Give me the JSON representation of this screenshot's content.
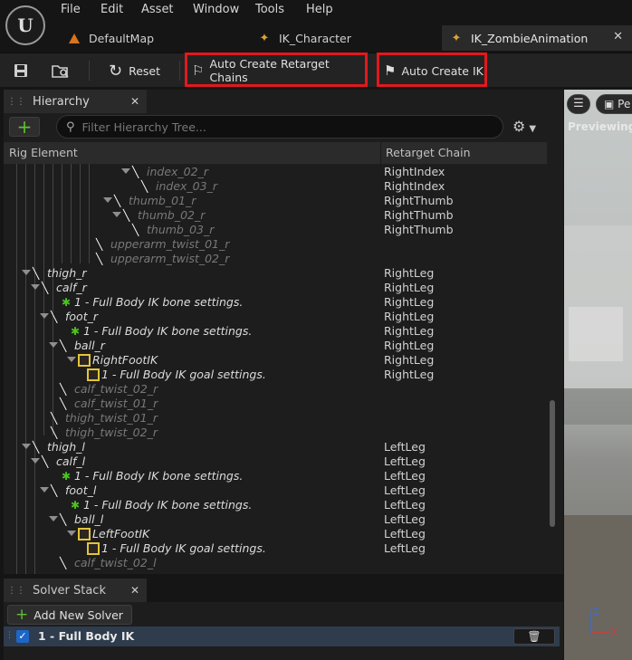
{
  "menu": [
    "File",
    "Edit",
    "Asset",
    "Window",
    "Tools",
    "Help"
  ],
  "tabs": [
    {
      "label": "DefaultMap",
      "icon": "level-map-icon"
    },
    {
      "label": "IK_Character",
      "icon": "ik-rig-icon"
    },
    {
      "label": "IK_ZombieAnimation",
      "icon": "ik-rig-icon"
    }
  ],
  "toolbar": {
    "reset_label": "Reset",
    "auto_retarget_label": "Auto Create Retarget Chains",
    "auto_ik_label": "Auto Create IK"
  },
  "hierarchy": {
    "tab_label": "Hierarchy",
    "search_placeholder": "Filter Hierarchy Tree...",
    "col_rig_element": "Rig Element",
    "col_retarget_chain": "Retarget Chain"
  },
  "tree_rows": [
    {
      "label": "index_02_r",
      "chain": "RightIndex",
      "depth": 13,
      "kind": "bone",
      "arrow": true,
      "dim": true
    },
    {
      "label": "index_03_r",
      "chain": "RightIndex",
      "depth": 14,
      "kind": "bone",
      "arrow": false,
      "dim": true
    },
    {
      "label": "thumb_01_r",
      "chain": "RightThumb",
      "depth": 11,
      "kind": "bone",
      "arrow": true,
      "dim": true
    },
    {
      "label": "thumb_02_r",
      "chain": "RightThumb",
      "depth": 12,
      "kind": "bone",
      "arrow": true,
      "dim": true
    },
    {
      "label": "thumb_03_r",
      "chain": "RightThumb",
      "depth": 13,
      "kind": "bone",
      "arrow": false,
      "dim": true
    },
    {
      "label": "upperarm_twist_01_r",
      "chain": "",
      "depth": 9,
      "kind": "bone",
      "arrow": false,
      "dim": true
    },
    {
      "label": "upperarm_twist_02_r",
      "chain": "",
      "depth": 9,
      "kind": "bone",
      "arrow": false,
      "dim": true
    },
    {
      "label": "thigh_r",
      "chain": "RightLeg",
      "depth": 2,
      "kind": "bone",
      "arrow": true,
      "dim": false
    },
    {
      "label": "calf_r",
      "chain": "RightLeg",
      "depth": 3,
      "kind": "bone",
      "arrow": true,
      "dim": false
    },
    {
      "label": "1 - Full Body IK bone settings.",
      "chain": "RightLeg",
      "depth": 5,
      "kind": "setting",
      "arrow": false,
      "dim": false
    },
    {
      "label": "foot_r",
      "chain": "RightLeg",
      "depth": 4,
      "kind": "bone",
      "arrow": true,
      "dim": false
    },
    {
      "label": "1 - Full Body IK bone settings.",
      "chain": "RightLeg",
      "depth": 6,
      "kind": "setting",
      "arrow": false,
      "dim": false
    },
    {
      "label": "ball_r",
      "chain": "RightLeg",
      "depth": 5,
      "kind": "bone",
      "arrow": true,
      "dim": false
    },
    {
      "label": "RightFootIK",
      "chain": "RightLeg",
      "depth": 7,
      "kind": "goal",
      "arrow": true,
      "dim": false
    },
    {
      "label": "1 - Full Body IK goal settings.",
      "chain": "RightLeg",
      "depth": 8,
      "kind": "goalsetting",
      "arrow": false,
      "dim": false
    },
    {
      "label": "calf_twist_02_r",
      "chain": "",
      "depth": 5,
      "kind": "bone",
      "arrow": false,
      "dim": true
    },
    {
      "label": "calf_twist_01_r",
      "chain": "",
      "depth": 5,
      "kind": "bone",
      "arrow": false,
      "dim": true
    },
    {
      "label": "thigh_twist_01_r",
      "chain": "",
      "depth": 4,
      "kind": "bone",
      "arrow": false,
      "dim": true
    },
    {
      "label": "thigh_twist_02_r",
      "chain": "",
      "depth": 4,
      "kind": "bone",
      "arrow": false,
      "dim": true
    },
    {
      "label": "thigh_l",
      "chain": "LeftLeg",
      "depth": 2,
      "kind": "bone",
      "arrow": true,
      "dim": false
    },
    {
      "label": "calf_l",
      "chain": "LeftLeg",
      "depth": 3,
      "kind": "bone",
      "arrow": true,
      "dim": false
    },
    {
      "label": "1 - Full Body IK bone settings.",
      "chain": "LeftLeg",
      "depth": 5,
      "kind": "setting",
      "arrow": false,
      "dim": false
    },
    {
      "label": "foot_l",
      "chain": "LeftLeg",
      "depth": 4,
      "kind": "bone",
      "arrow": true,
      "dim": false
    },
    {
      "label": "1 - Full Body IK bone settings.",
      "chain": "LeftLeg",
      "depth": 6,
      "kind": "setting",
      "arrow": false,
      "dim": false
    },
    {
      "label": "ball_l",
      "chain": "LeftLeg",
      "depth": 5,
      "kind": "bone",
      "arrow": true,
      "dim": false
    },
    {
      "label": "LeftFootIK",
      "chain": "LeftLeg",
      "depth": 7,
      "kind": "goal",
      "arrow": true,
      "dim": false
    },
    {
      "label": "1 - Full Body IK goal settings.",
      "chain": "LeftLeg",
      "depth": 8,
      "kind": "goalsetting",
      "arrow": false,
      "dim": false
    },
    {
      "label": "calf_twist_02_l",
      "chain": "",
      "depth": 5,
      "kind": "bone",
      "arrow": false,
      "dim": true
    }
  ],
  "solver": {
    "tab_label": "Solver Stack",
    "add_label": "Add New Solver",
    "item_label": "1 - Full Body IK",
    "item_enabled": true
  },
  "viewport": {
    "perspective_label": "Pe",
    "previewing_label": "Previewing R"
  },
  "colors": {
    "accent_red": "#e0191e",
    "ik_green": "#4cc420",
    "goal_yellow": "#e3c43b",
    "selection": "#2e3c4d"
  }
}
